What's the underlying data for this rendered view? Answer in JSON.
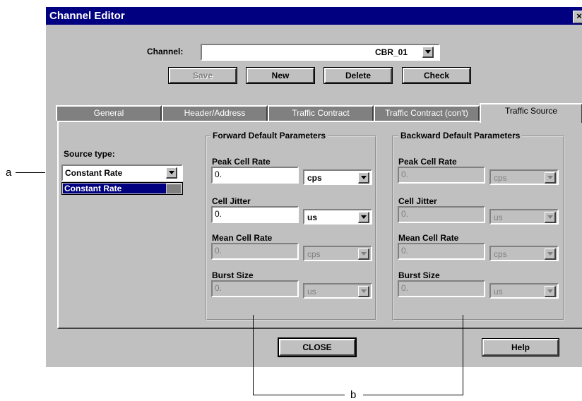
{
  "window": {
    "title": "Channel Editor",
    "close_glyph": "×"
  },
  "channel": {
    "label": "Channel:",
    "value": "CBR_01"
  },
  "buttons": {
    "save": "Save",
    "new": "New",
    "delete": "Delete",
    "check": "Check",
    "close": "CLOSE",
    "help": "Help"
  },
  "tabs": [
    "General",
    "Header/Address",
    "Traffic Contract",
    "Traffic Contract (con't)",
    "Traffic Source"
  ],
  "source": {
    "label": "Source type:",
    "value": "Constant Rate",
    "list_item": "Constant Rate"
  },
  "forward": {
    "title": "Forward Default Parameters",
    "peak": {
      "label": "Peak Cell Rate",
      "value": "0.",
      "unit": "cps"
    },
    "jitter": {
      "label": "Cell Jitter",
      "value": "0.",
      "unit": "us"
    },
    "mean": {
      "label": "Mean Cell Rate",
      "value": "0.",
      "unit": "cps"
    },
    "burst": {
      "label": "Burst Size",
      "value": "0.",
      "unit": "us"
    }
  },
  "backward": {
    "title": "Backward Default Parameters",
    "peak": {
      "label": "Peak Cell Rate",
      "value": "0.",
      "unit": "cps"
    },
    "jitter": {
      "label": "Cell Jitter",
      "value": "0.",
      "unit": "us"
    },
    "mean": {
      "label": "Mean Cell Rate",
      "value": "0.",
      "unit": "cps"
    },
    "burst": {
      "label": "Burst Size",
      "value": "0.",
      "unit": "us"
    }
  },
  "callouts": {
    "a": "a",
    "b": "b"
  },
  "icons": {
    "dropdown": "chevron-down-icon",
    "close": "close-icon"
  }
}
